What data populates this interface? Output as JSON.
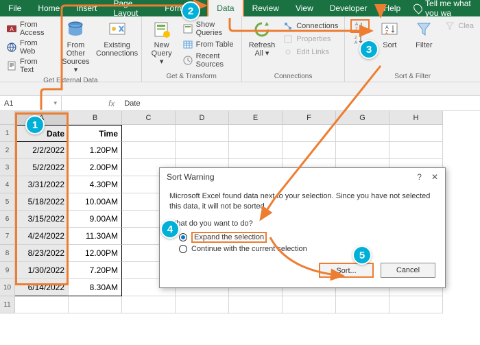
{
  "tabs": {
    "file": "File",
    "home": "Home",
    "insert": "Insert",
    "pagelayout": "Page Layout",
    "formulas": "Formulas",
    "data": "Data",
    "review": "Review",
    "view": "View",
    "developer": "Developer",
    "help": "Help",
    "tellme": "Tell me what you wa"
  },
  "ribbon": {
    "getExternal": {
      "label": "Get External Data",
      "fromAccess": "From Access",
      "fromWeb": "From Web",
      "fromText": "From Text",
      "fromOther": "From Other\nSources",
      "existing": "Existing\nConnections"
    },
    "getTransform": {
      "label": "Get & Transform",
      "newQuery": "New\nQuery",
      "showQueries": "Show Queries",
      "fromTable": "From Table",
      "recentSources": "Recent Sources"
    },
    "connections": {
      "label": "Connections",
      "refreshAll": "Refresh\nAll",
      "conn": "Connections",
      "properties": "Properties",
      "editLinks": "Edit Links"
    },
    "sortFilter": {
      "label": "Sort & Filter",
      "sort": "Sort",
      "filter": "Filter",
      "clear": "Clea"
    }
  },
  "namebox": {
    "ref": "A1",
    "value": "Date"
  },
  "cols": [
    "A",
    "B",
    "C",
    "D",
    "E",
    "F",
    "G",
    "H"
  ],
  "headerRow": {
    "date": "Date",
    "time": "Time"
  },
  "rows": [
    {
      "n": "2",
      "date": "2/2/2022",
      "time": "1.20PM"
    },
    {
      "n": "3",
      "date": "5/2/2022",
      "time": "2.00PM"
    },
    {
      "n": "4",
      "date": "3/31/2022",
      "time": "4.30PM"
    },
    {
      "n": "5",
      "date": "5/18/2022",
      "time": "10.00AM"
    },
    {
      "n": "6",
      "date": "3/15/2022",
      "time": "9.00AM"
    },
    {
      "n": "7",
      "date": "4/24/2022",
      "time": "11.30AM"
    },
    {
      "n": "8",
      "date": "8/23/2022",
      "time": "12.00PM"
    },
    {
      "n": "9",
      "date": "1/30/2022",
      "time": "7.20PM"
    },
    {
      "n": "10",
      "date": "6/14/2022",
      "time": "8.30AM"
    }
  ],
  "dialog": {
    "title": "Sort Warning",
    "help": "?",
    "close": "✕",
    "message": "Microsoft Excel found data next to your selection.  Since you have not selected this data, it will not be sorted.",
    "question": "What do you want to do?",
    "opt1": "Expand the selection",
    "opt2": "Continue with the current selection",
    "sort": "Sort...",
    "cancel": "Cancel"
  },
  "steps": {
    "s1": "1",
    "s2": "2",
    "s3": "3",
    "s4": "4",
    "s5": "5"
  }
}
